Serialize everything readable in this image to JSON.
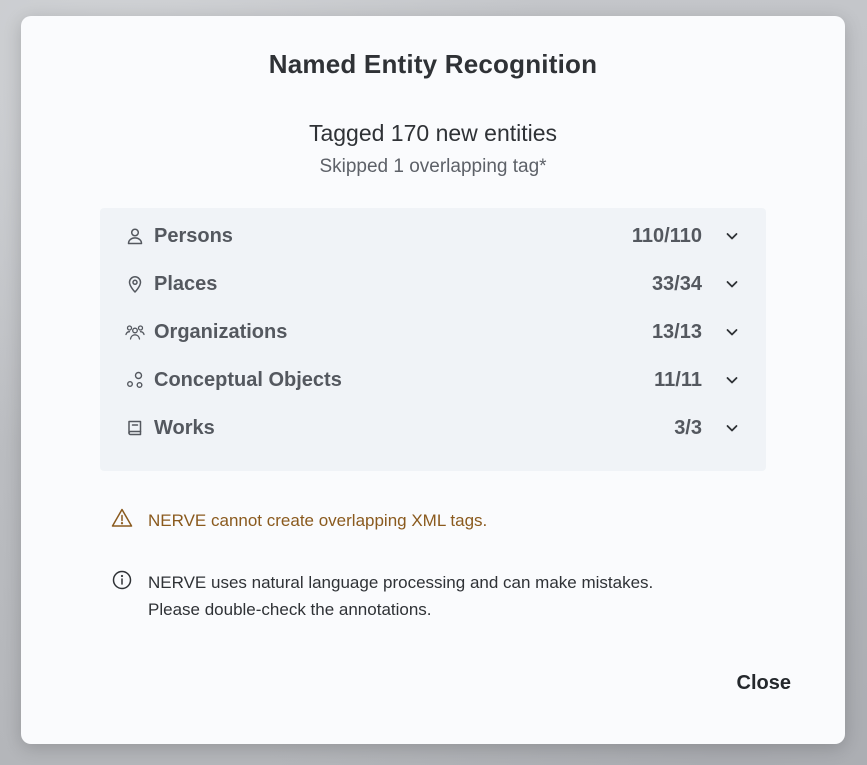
{
  "dialog": {
    "title": "Named Entity Recognition",
    "summary": "Tagged 170 new entities",
    "subsummary": "Skipped 1 overlapping tag*"
  },
  "entities": [
    {
      "icon": "person-icon",
      "label": "Persons",
      "count": "110/110"
    },
    {
      "icon": "map-pin-icon",
      "label": "Places",
      "count": "33/34"
    },
    {
      "icon": "group-icon",
      "label": "Organizations",
      "count": "13/13"
    },
    {
      "icon": "shapes-icon",
      "label": "Conceptual Objects",
      "count": "11/11"
    },
    {
      "icon": "book-icon",
      "label": "Works",
      "count": "3/3"
    }
  ],
  "notes": {
    "warning": {
      "icon": "warning-triangle-icon",
      "line1": "NERVE cannot create overlapping XML tags."
    },
    "info": {
      "icon": "info-circle-icon",
      "line1": "NERVE uses natural language processing and can make mistakes.",
      "line2": "Please double-check the annotations."
    }
  },
  "footer": {
    "close_label": "Close"
  },
  "colors": {
    "warning_text": "#8a5a1e",
    "panel_bg": "#f0f3f7",
    "dialog_bg": "#fafbfd"
  }
}
